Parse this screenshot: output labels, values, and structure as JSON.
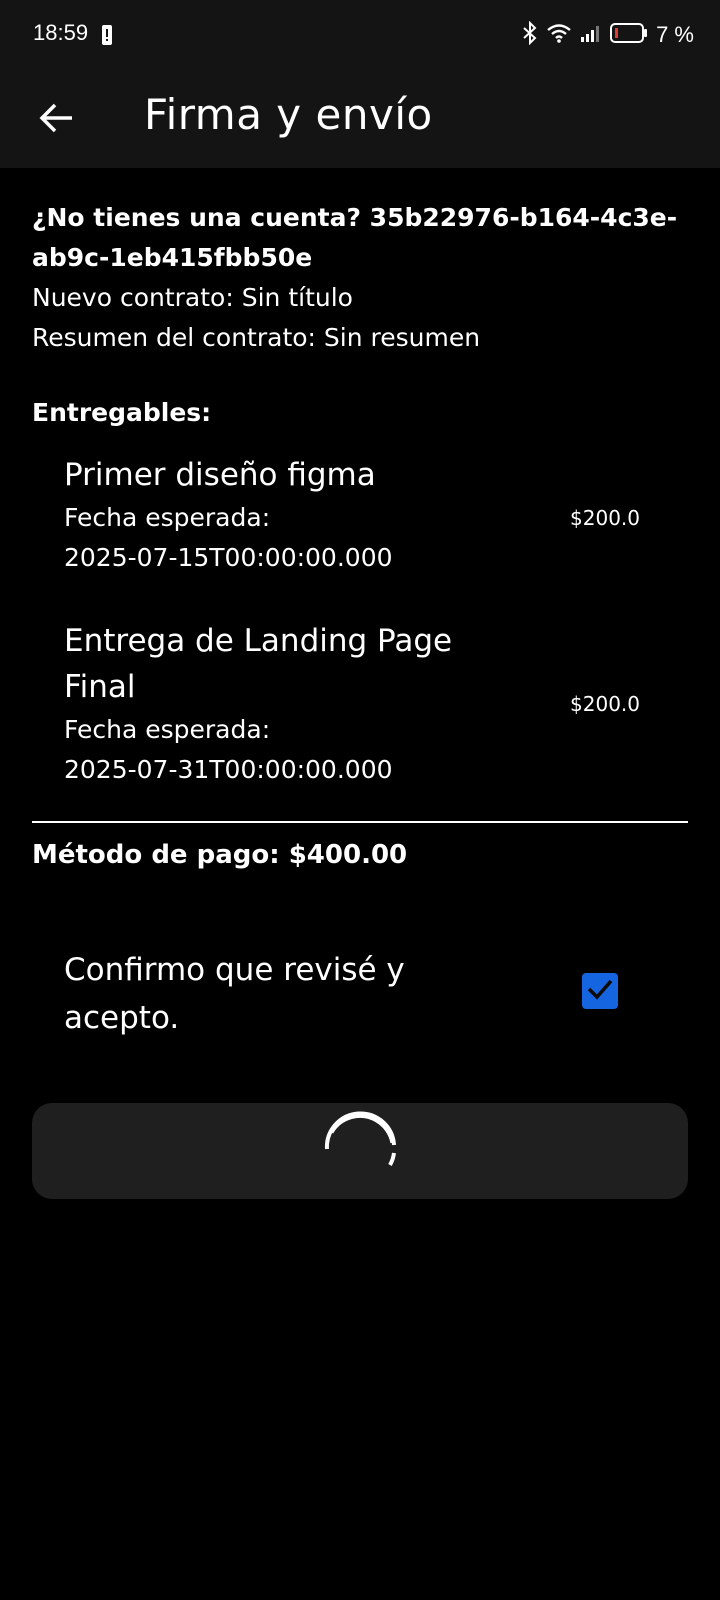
{
  "status_bar": {
    "time": "18:59",
    "battery_percent": "7 %",
    "icons": [
      "alert-icon",
      "bluetooth-icon",
      "wifi-icon",
      "signal-icon",
      "battery-icon"
    ]
  },
  "app_bar": {
    "title": "Firma y envío",
    "back_icon": "arrow-back-icon"
  },
  "account": {
    "text": "¿No tienes una cuenta?  35b22976-b164-4c3e-ab9c-1eb415fbb50e"
  },
  "contract": {
    "new_contract": "Nuevo contrato: Sin título",
    "summary": "Resumen del contrato: Sin resumen"
  },
  "deliverables": {
    "label": "Entregables:",
    "items": [
      {
        "title": "Primer diseño figma",
        "date_label": "Fecha esperada:",
        "date": "2025-07-15T00:00:00.000",
        "price": "$200.0"
      },
      {
        "title": "Entrega de Landing Page Final",
        "date_label": "Fecha esperada:",
        "date": "2025-07-31T00:00:00.000",
        "price": "$200.0"
      }
    ]
  },
  "payment": {
    "text": "Método de pago: $400.00"
  },
  "confirm": {
    "label": "Confirmo que revisé y acepto.",
    "checked": true
  },
  "submit": {
    "state": "loading"
  },
  "colors": {
    "background": "#000000",
    "bar": "#141414",
    "accent": "#1565e0",
    "button": "#1f1f1f",
    "battery_low": "#e53935"
  }
}
